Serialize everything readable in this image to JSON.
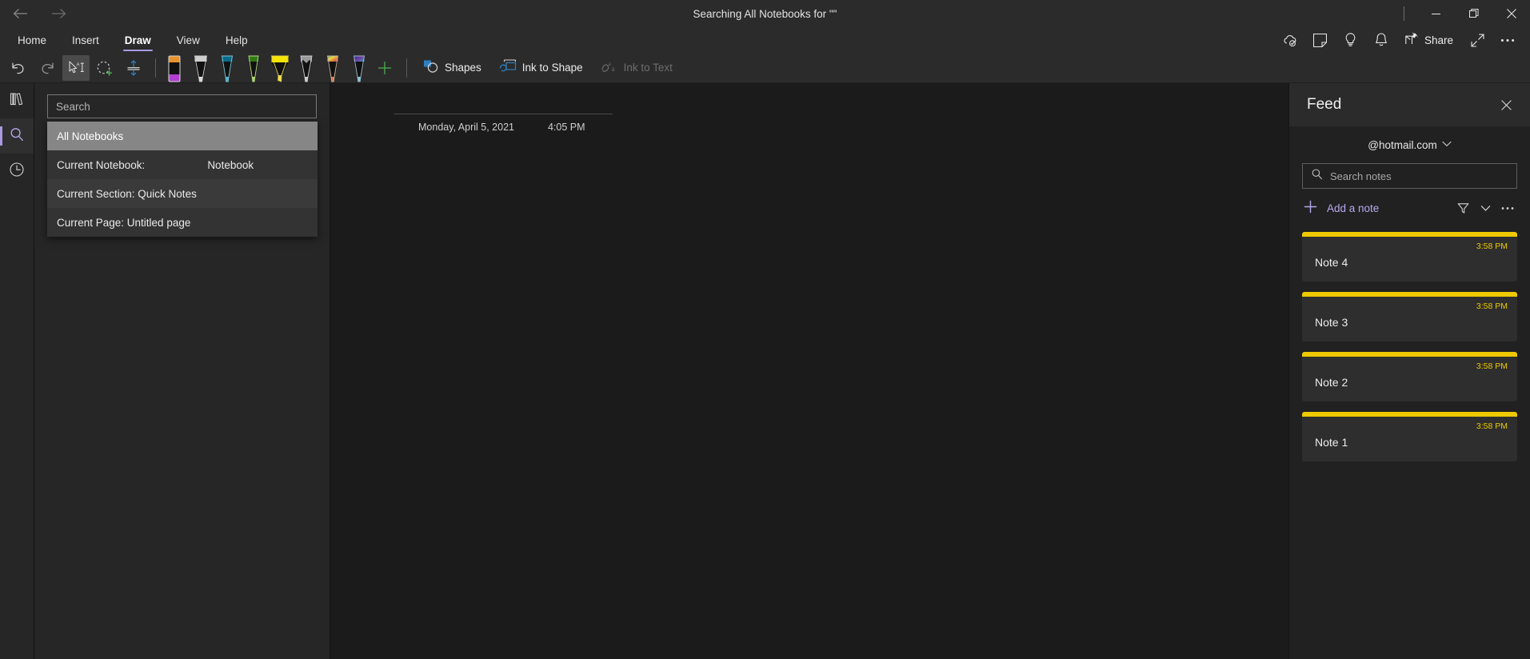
{
  "window": {
    "title": "Searching All Notebooks for \"\"",
    "nav": {
      "back": "←",
      "forward": "→"
    },
    "controls": {
      "minimize": "minimize",
      "restore": "restore",
      "close": "close"
    }
  },
  "ribbon": {
    "tabs": [
      {
        "label": "Home",
        "active": false
      },
      {
        "label": "Insert",
        "active": false
      },
      {
        "label": "Draw",
        "active": true
      },
      {
        "label": "View",
        "active": false
      },
      {
        "label": "Help",
        "active": false
      }
    ],
    "right_icons": [
      {
        "name": "cloud-sync-icon"
      },
      {
        "name": "sticky-note-icon"
      },
      {
        "name": "lightbulb-icon"
      },
      {
        "name": "bell-icon"
      }
    ],
    "share_label": "Share",
    "expand_icon": "expand-icon",
    "more_icon": "more-options-icon"
  },
  "toolbar": {
    "undo_label": "Undo",
    "redo_label": "Redo",
    "select_label": "Select text",
    "lasso_label": "Lasso Select",
    "insert_space_label": "Insert Space",
    "add_pen_label": "Add Pen",
    "shapes_label": "Shapes",
    "ink_to_shape_label": "Ink to Shape",
    "ink_to_text_label": "Ink to Text",
    "pens": [
      {
        "name": "eraser",
        "cap": "#e8922c",
        "body": "#111111",
        "tip": "#b03fd0",
        "shape": "eraser"
      },
      {
        "name": "pen-white",
        "cap": "#cfcfcf",
        "body": "#111111",
        "tip": "#d8d8d8",
        "shape": "pen"
      },
      {
        "name": "pen-teal",
        "cap": "#0b6a8a",
        "body": "#111111",
        "tip": "#3fb5c9",
        "shape": "pen"
      },
      {
        "name": "pen-green",
        "cap": "#2f7a14",
        "body": "#111111",
        "tip": "#a8d26a",
        "shape": "pen"
      },
      {
        "name": "highlighter-yellow",
        "cap": "#f6e400",
        "body": "#111111",
        "tip": "#f1dd4b",
        "shape": "highlighter"
      },
      {
        "name": "pencil-gray",
        "cap": "#9a9a9a",
        "body": "#111111",
        "tip": "#cccccc",
        "shape": "pencil"
      },
      {
        "name": "pen-rainbow",
        "cap": "#3fa14a",
        "body": "#111111",
        "tip": "#d07a4e",
        "shape": "pen"
      },
      {
        "name": "pen-galaxy",
        "cap": "#4a4ab0",
        "body": "#111111",
        "tip": "#7fc8d8",
        "shape": "pen"
      }
    ]
  },
  "rail": {
    "items": [
      {
        "name": "notebooks",
        "label": "Show Notebooks",
        "active": false
      },
      {
        "name": "search",
        "label": "Search",
        "active": true
      },
      {
        "name": "recent",
        "label": "Recent Notes",
        "active": false
      }
    ]
  },
  "search_panel": {
    "input_value": "",
    "placeholder": "Search",
    "scope_options": [
      {
        "label": "All Notebooks",
        "value": "",
        "state": "highlight"
      },
      {
        "label": "Current Notebook:",
        "value": "Notebook",
        "state": "normal"
      },
      {
        "label": "Current Section: Quick Notes",
        "value": "",
        "state": "alt"
      },
      {
        "label": "Current Page: Untitled page",
        "value": "",
        "state": "normal"
      }
    ]
  },
  "page": {
    "title": "",
    "date": "Monday, April 5, 2021",
    "time": "4:05 PM"
  },
  "feed": {
    "title": "Feed",
    "close_label": "Close",
    "account": "@hotmail.com",
    "search_placeholder": "Search notes",
    "search_value": "",
    "add_note_label": "Add a note",
    "filter_icon": "filter-icon",
    "sort_icon": "chevron-down-icon",
    "more_icon": "more-options-icon",
    "notes": [
      {
        "time": "3:58 PM",
        "title": "Note 4",
        "accent": "#eec900"
      },
      {
        "time": "3:58 PM",
        "title": "Note 3",
        "accent": "#eec900"
      },
      {
        "time": "3:58 PM",
        "title": "Note 2",
        "accent": "#eec900"
      },
      {
        "time": "3:58 PM",
        "title": "Note 1",
        "accent": "#eec900"
      }
    ]
  },
  "colors": {
    "accent": "#a99ae0",
    "note_accent": "#eec900",
    "bg": "#1b1b1b",
    "chrome": "#2b2b2b"
  }
}
